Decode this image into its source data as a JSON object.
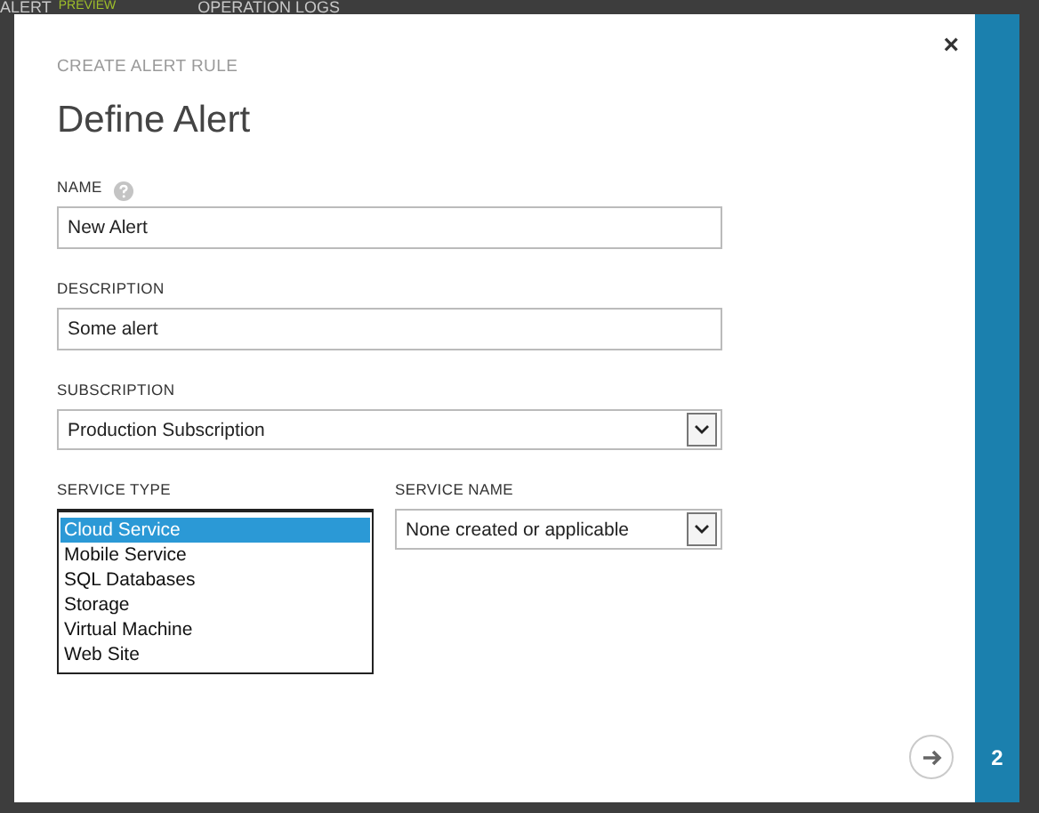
{
  "top_bar": {
    "tabs": [
      {
        "label": "ALERT",
        "tag": "PREVIEW"
      },
      {
        "label": "OPERATION LOGS"
      }
    ]
  },
  "dialog": {
    "subtitle": "CREATE ALERT RULE",
    "title": "Define Alert",
    "close": "×",
    "fields": [
      {
        "kind": "text",
        "label": "NAME",
        "help": true,
        "value": "New Alert"
      },
      {
        "kind": "text",
        "label": "DESCRIPTION",
        "help": false,
        "value": "Some alert"
      },
      {
        "kind": "select",
        "label": "SUBSCRIPTION",
        "help": false,
        "value": "Production Subscription"
      }
    ],
    "service_type": {
      "label": "SERVICE TYPE",
      "options": [
        {
          "label": "Cloud Service",
          "selected": true
        },
        {
          "label": "Mobile Service",
          "selected": false
        },
        {
          "label": "SQL Databases",
          "selected": false
        },
        {
          "label": "Storage",
          "selected": false
        },
        {
          "label": "Virtual Machine",
          "selected": false
        },
        {
          "label": "Web Site",
          "selected": false
        }
      ]
    },
    "service_name": {
      "label": "SERVICE NAME",
      "value": "None created or applicable"
    }
  },
  "step": {
    "number": "2"
  }
}
